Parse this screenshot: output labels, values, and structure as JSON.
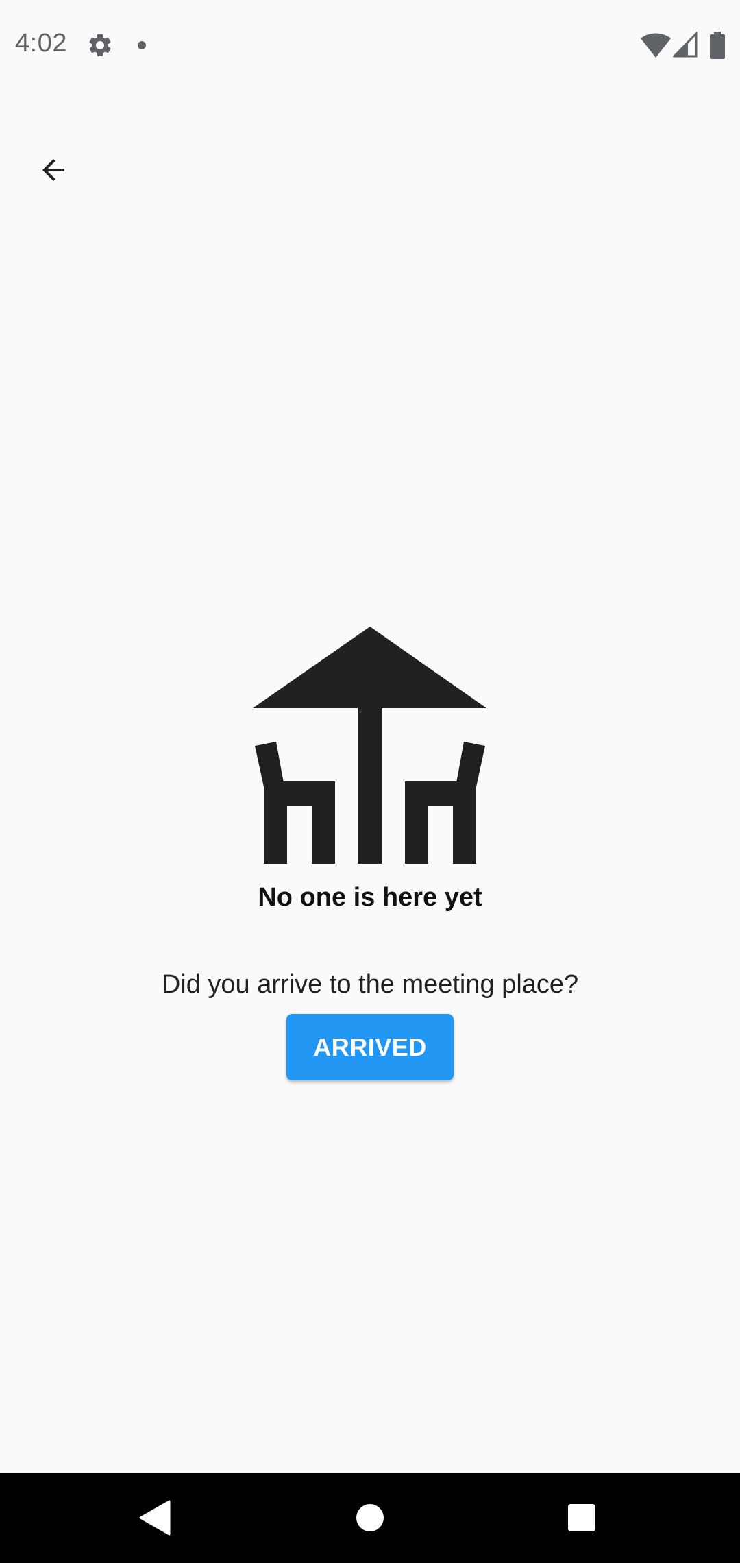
{
  "status_bar": {
    "time": "4:02",
    "icons": [
      "gear-icon",
      "notification-dot-icon",
      "wifi-icon",
      "signal-icon",
      "battery-icon"
    ]
  },
  "app_bar": {
    "back_icon": "arrow-back-icon"
  },
  "empty_state": {
    "illustration_icon": "table-umbrella-chairs-icon",
    "title": "No one is here yet"
  },
  "arrival": {
    "question": "Did you arrive to the meeting place?",
    "button_label": "ARRIVED",
    "button_color": "#2196f3"
  },
  "nav_bar": {
    "icons": [
      "nav-back-icon",
      "nav-home-icon",
      "nav-recents-icon"
    ]
  }
}
